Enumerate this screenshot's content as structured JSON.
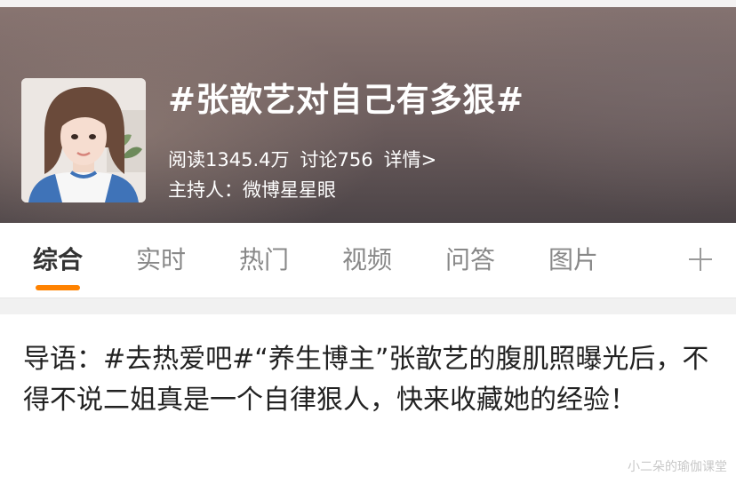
{
  "topic": {
    "title": "#张歆艺对自己有多狠#",
    "reads": "阅读1345.4万",
    "discussions": "讨论756",
    "details_link": "详情>",
    "host": "主持人：微博星星眼"
  },
  "tabs": [
    {
      "label": "综合",
      "active": true
    },
    {
      "label": "实时",
      "active": false
    },
    {
      "label": "热门",
      "active": false
    },
    {
      "label": "视频",
      "active": false
    },
    {
      "label": "问答",
      "active": false
    },
    {
      "label": "图片",
      "active": false
    }
  ],
  "tab_add_icon": "plus-icon",
  "intro_text": "导语：#去热爱吧#“养生博主”张歆艺的腹肌照曝光后，不得不说二姐真是一个自律狠人，快来收藏她的经验！",
  "watermark": "小二朵的瑜伽课堂",
  "colors": {
    "accent": "#ff8200",
    "tab_active": "#333333",
    "tab_inactive": "#888888"
  }
}
